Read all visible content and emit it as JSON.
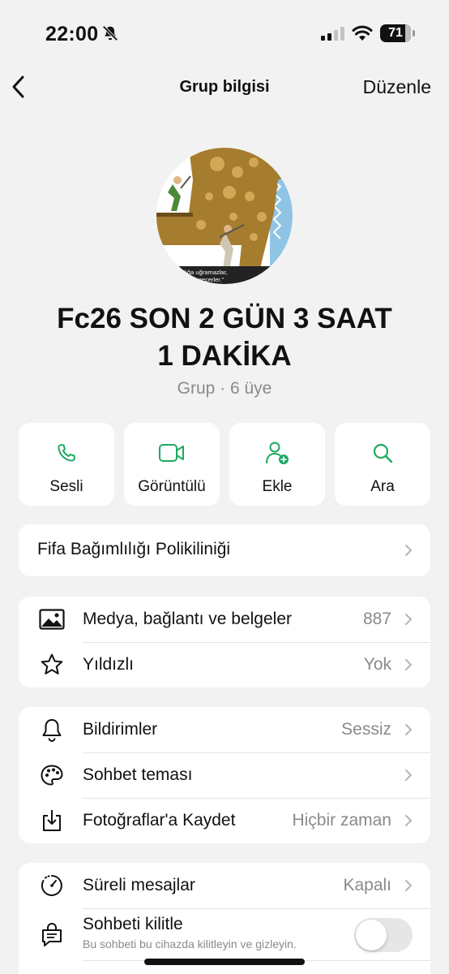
{
  "status_bar": {
    "time": "22:00",
    "battery": "71"
  },
  "nav": {
    "title": "Grup bilgisi",
    "edit_label": "Düzenle"
  },
  "avatar": {
    "caption_line1": "asarısızlığa uğramazlar,",
    "caption_line2": "vazgeçerler.\""
  },
  "group": {
    "name_line1": "Fc26 SON 2 GÜN 3 SAAT",
    "name_line2": "1 DAKİKA",
    "subtitle": "Grup · 6 üye"
  },
  "actions": [
    {
      "label": "Sesli",
      "icon": "phone-icon"
    },
    {
      "label": "Görüntülü",
      "icon": "video-icon"
    },
    {
      "label": "Ekle",
      "icon": "add-person-icon"
    },
    {
      "label": "Ara",
      "icon": "search-icon"
    }
  ],
  "description": {
    "text": "Fifa Bağımlılığı Polikiliniği"
  },
  "media_section": [
    {
      "label": "Medya, bağlantı ve belgeler",
      "value": "887",
      "icon": "photo-icon"
    },
    {
      "label": "Yıldızlı",
      "value": "Yok",
      "icon": "star-icon"
    }
  ],
  "settings_section": [
    {
      "label": "Bildirimler",
      "value": "Sessiz",
      "icon": "bell-icon"
    },
    {
      "label": "Sohbet teması",
      "value": "",
      "icon": "palette-icon"
    },
    {
      "label": "Fotoğraflar'a Kaydet",
      "value": "Hiçbir zaman",
      "icon": "download-icon"
    }
  ],
  "privacy_section": {
    "disappearing": {
      "label": "Süreli mesajlar",
      "value": "Kapalı",
      "icon": "timer-icon"
    },
    "lock": {
      "label": "Sohbeti kilitle",
      "sub": "Bu sohbeti bu cihazda kilitleyin ve gizleyin.",
      "icon": "lock-chat-icon",
      "enabled": false
    }
  },
  "colors": {
    "accent": "#1DAA61",
    "background": "#F2F2F2",
    "card": "#FFFFFF",
    "secondary_text": "#8A8A8A"
  }
}
